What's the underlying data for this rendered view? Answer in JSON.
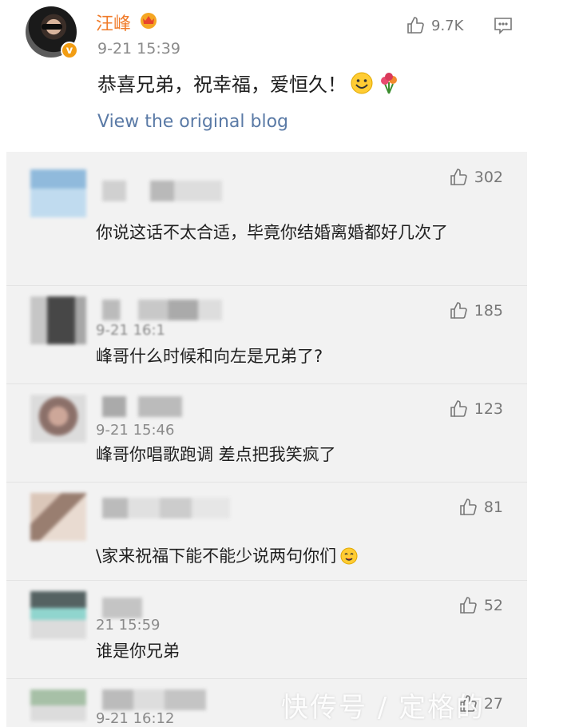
{
  "post": {
    "username": "汪峰",
    "time": "9-21 15:39",
    "likes": "9.7K",
    "text": "恭喜兄弟，祝幸福，爱恒久！",
    "view_original": "View the original blog",
    "badge": "v",
    "icons": [
      "avatar",
      "vip-crown-icon",
      "thumb-up-icon",
      "comment-icon",
      "smile-emoji-icon",
      "flowers-emoji-icon"
    ]
  },
  "comments": [
    {
      "time": "",
      "likes": "302",
      "text": "你说这话不太合适，毕竟你结婚离婚都好几次了"
    },
    {
      "time": "9-21 16:1",
      "likes": "185",
      "text": "峰哥什么时候和向左是兄弟了?"
    },
    {
      "time": "9-21 15:46",
      "likes": "123",
      "text": "峰哥你唱歌跑调 差点把我笑疯了"
    },
    {
      "time": "",
      "likes": "81",
      "text": "\\家来祝福下能不能少说两句你们"
    },
    {
      "time": "21 15:59",
      "likes": "52",
      "text": "谁是你兄弟"
    },
    {
      "time": "9-21 16:12",
      "likes": "27",
      "text": ""
    }
  ],
  "watermark": "快传号 / 定格的",
  "colors": {
    "username": "#f07b2a",
    "link": "#5a7aa6",
    "comments_bg": "#f2f2f2"
  }
}
